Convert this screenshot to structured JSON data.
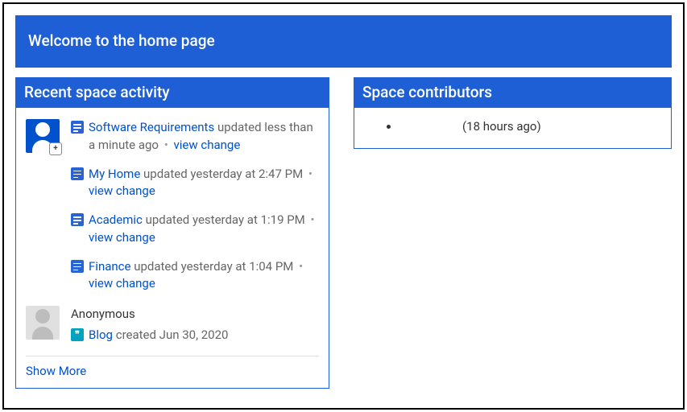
{
  "banner": {
    "title": "Welcome to the home page"
  },
  "activity": {
    "title": "Recent space activity",
    "entries": [
      {
        "title": "Software Requirements",
        "meta": " updated less than a minute ago",
        "action": "view change"
      },
      {
        "title": "My Home",
        "meta": " updated yesterday at 2:47 PM",
        "action": "view change"
      },
      {
        "title": "Academic",
        "meta": " updated yesterday at 1:19 PM",
        "action": "view change"
      },
      {
        "title": "Finance",
        "meta": " updated yesterday at 1:04 PM",
        "action": "view change"
      }
    ],
    "author2": {
      "name": "Anonymous",
      "entry": {
        "title": "Blog",
        "meta": " created Jun 30, 2020"
      }
    },
    "show_more": "Show More"
  },
  "contributors": {
    "title": "Space contributors",
    "items": [
      {
        "time": "(18 hours ago)"
      }
    ]
  }
}
